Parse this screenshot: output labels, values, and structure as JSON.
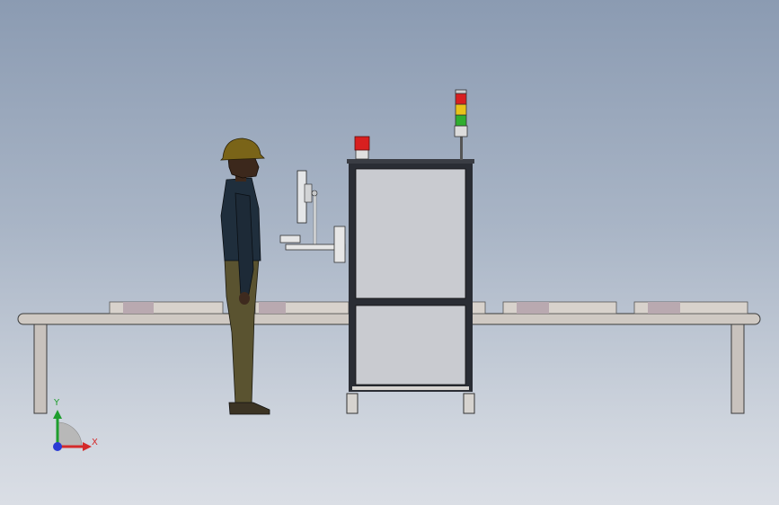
{
  "scene": {
    "description_visible": false,
    "colors": {
      "background_top": "#8b9bb2",
      "background_bottom": "#dadee5",
      "frame": "#2a2d34",
      "panel": "#c9cbd0",
      "conveyor": "#c8c2bd",
      "beacon_red": "#d81f1f",
      "stack_red": "#d81f1f",
      "stack_yellow": "#e8c21a",
      "stack_green": "#2fae2f",
      "shirt": "#1f2e3c",
      "trousers": "#5a5330",
      "helmet": "#7a6418"
    }
  },
  "axis_triad": {
    "x_label": "X",
    "y_label": "Y",
    "x_color": "#d42a2a",
    "y_color": "#1e9e2e",
    "z_color": "#2a3bd4"
  }
}
